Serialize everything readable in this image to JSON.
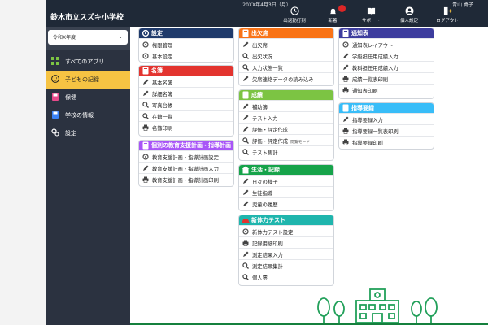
{
  "header": {
    "date": "20XX年4月3日（月）",
    "user": "青山 勇子",
    "school": "鈴木市立スズキ小学校",
    "tools": [
      {
        "label": "出退勤打刻",
        "icon": "clock-icon"
      },
      {
        "label": "新着",
        "icon": "bell-icon"
      },
      {
        "label": "サポート",
        "icon": "book-icon"
      },
      {
        "label": "個人設定",
        "icon": "user-icon"
      },
      {
        "label": "ログアウト",
        "icon": "logout-icon"
      }
    ]
  },
  "sidebar": {
    "year": "令和X年度",
    "items": [
      {
        "label": "すべてのアプリ",
        "icon": "grid-icon",
        "active": false
      },
      {
        "label": "子どもの記録",
        "icon": "smile-icon",
        "active": true
      },
      {
        "label": "保健",
        "icon": "health-book-icon",
        "active": false
      },
      {
        "label": "学校の情報",
        "icon": "info-book-icon",
        "active": false
      },
      {
        "label": "設定",
        "icon": "gears-icon",
        "active": false
      }
    ]
  },
  "colors": {
    "topbar": "#1f2937",
    "sidebar": "#2b3240",
    "active": "#f6c343",
    "settings": "#1f3a6b",
    "roster": "#e3342f",
    "support": "#a855f7",
    "attendance": "#f97316",
    "grades": "#7cc443",
    "life": "#16a34a",
    "fitness": "#1fb5ad",
    "report": "#3d3d9e",
    "guidance": "#38bdf8"
  },
  "cards": {
    "settings": {
      "title": "設定",
      "rows": [
        {
          "label": "権限管理",
          "icon": "gear-icon"
        },
        {
          "label": "基本設定",
          "icon": "gear-icon"
        }
      ]
    },
    "roster": {
      "title": "名簿",
      "rows": [
        {
          "label": "基本名簿",
          "icon": "pencil-icon"
        },
        {
          "label": "詳細名簿",
          "icon": "pencil-icon"
        },
        {
          "label": "写真台帳",
          "icon": "search-icon"
        },
        {
          "label": "在籍一覧",
          "icon": "search-icon"
        },
        {
          "label": "名簿印刷",
          "icon": "printer-icon"
        }
      ]
    },
    "support": {
      "title": "個別の教育支援計画・指導計画",
      "rows": [
        {
          "label": "教育支援計画・指導計画設定",
          "icon": "gear-icon"
        },
        {
          "label": "教育支援計画・指導計画入力",
          "icon": "pencil-icon"
        },
        {
          "label": "教育支援計画・指導計画印刷",
          "icon": "printer-icon"
        }
      ]
    },
    "attendance": {
      "title": "出欠席",
      "rows": [
        {
          "label": "出欠席",
          "icon": "pencil-icon"
        },
        {
          "label": "出欠状況",
          "icon": "search-icon"
        },
        {
          "label": "入力状態一覧",
          "icon": "search-icon"
        },
        {
          "label": "欠席連絡データの読み込み",
          "icon": "pencil-icon"
        }
      ]
    },
    "grades": {
      "title": "成績",
      "rows": [
        {
          "label": "補助簿",
          "icon": "pencil-icon"
        },
        {
          "label": "テスト入力",
          "icon": "pencil-icon"
        },
        {
          "label": "評価・評定作成",
          "icon": "pencil-icon"
        },
        {
          "label": "評価・評定作成",
          "note": "閲覧モード",
          "icon": "search-icon"
        },
        {
          "label": "テスト集計",
          "icon": "search-icon"
        }
      ]
    },
    "life": {
      "title": "生活・記録",
      "rows": [
        {
          "label": "日々の様子",
          "icon": "pencil-icon"
        },
        {
          "label": "生徒指導",
          "icon": "pencil-icon"
        },
        {
          "label": "児童の履歴",
          "icon": "pencil-icon"
        }
      ]
    },
    "fitness": {
      "title": "新体力テスト",
      "rows": [
        {
          "label": "新体力テスト設定",
          "icon": "gear-icon"
        },
        {
          "label": "記録用紙印刷",
          "icon": "printer-icon"
        },
        {
          "label": "測定結果入力",
          "icon": "pencil-icon"
        },
        {
          "label": "測定結果集計",
          "icon": "search-icon"
        },
        {
          "label": "個人票",
          "icon": "search-icon"
        }
      ]
    },
    "report": {
      "title": "通知表",
      "rows": [
        {
          "label": "通知表レイアウト",
          "icon": "gear-icon"
        },
        {
          "label": "学級担任用成績入力",
          "icon": "pencil-icon"
        },
        {
          "label": "教科担任用成績入力",
          "icon": "pencil-icon"
        },
        {
          "label": "成績一覧表印刷",
          "icon": "printer-icon"
        },
        {
          "label": "通知表印刷",
          "icon": "printer-icon"
        }
      ]
    },
    "guidance": {
      "title": "指導要録",
      "rows": [
        {
          "label": "指導要録入力",
          "icon": "pencil-icon"
        },
        {
          "label": "指導要録一覧表印刷",
          "icon": "printer-icon"
        },
        {
          "label": "指導要録印刷",
          "icon": "printer-icon"
        }
      ]
    }
  }
}
